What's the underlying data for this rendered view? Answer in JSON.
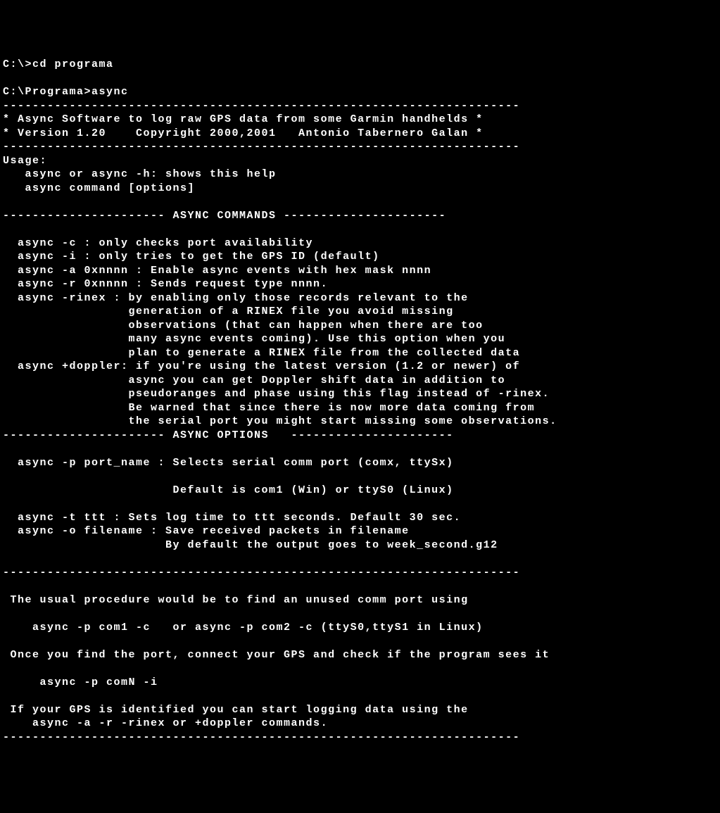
{
  "lines": [
    "C:\\>cd programa",
    "",
    "C:\\Programa>async",
    "----------------------------------------------------------------------",
    "* Async Software to log raw GPS data from some Garmin handhelds *",
    "* Version 1.20    Copyright 2000,2001   Antonio Tabernero Galan *",
    "----------------------------------------------------------------------",
    "Usage:",
    "   async or async -h: shows this help",
    "   async command [options]",
    "",
    "---------------------- ASYNC COMMANDS ----------------------",
    "",
    "  async -c : only checks port availability",
    "  async -i : only tries to get the GPS ID (default)",
    "  async -a 0xnnnn : Enable async events with hex mask nnnn",
    "  async -r 0xnnnn : Sends request type nnnn.",
    "  async -rinex : by enabling only those records relevant to the",
    "                 generation of a RINEX file you avoid missing",
    "                 observations (that can happen when there are too",
    "                 many async events coming). Use this option when you",
    "                 plan to generate a RINEX file from the collected data",
    "  async +doppler: if you're using the latest version (1.2 or newer) of",
    "                 async you can get Doppler shift data in addition to",
    "                 pseudoranges and phase using this flag instead of -rinex.",
    "                 Be warned that since there is now more data coming from",
    "                 the serial port you might start missing some observations.",
    "---------------------- ASYNC OPTIONS   ----------------------",
    "",
    "  async -p port_name : Selects serial comm port (comx, ttySx)",
    "",
    "                       Default is com1 (Win) or ttyS0 (Linux)",
    "",
    "  async -t ttt : Sets log time to ttt seconds. Default 30 sec.",
    "  async -o filename : Save received packets in filename",
    "                      By default the output goes to week_second.g12",
    "",
    "----------------------------------------------------------------------",
    "",
    " The usual procedure would be to find an unused comm port using",
    "",
    "    async -p com1 -c   or async -p com2 -c (ttyS0,ttyS1 in Linux)",
    "",
    " Once you find the port, connect your GPS and check if the program sees it",
    "",
    "     async -p comN -i",
    "",
    " If your GPS is identified you can start logging data using the",
    "    async -a -r -rinex or +doppler commands.",
    "----------------------------------------------------------------------"
  ]
}
